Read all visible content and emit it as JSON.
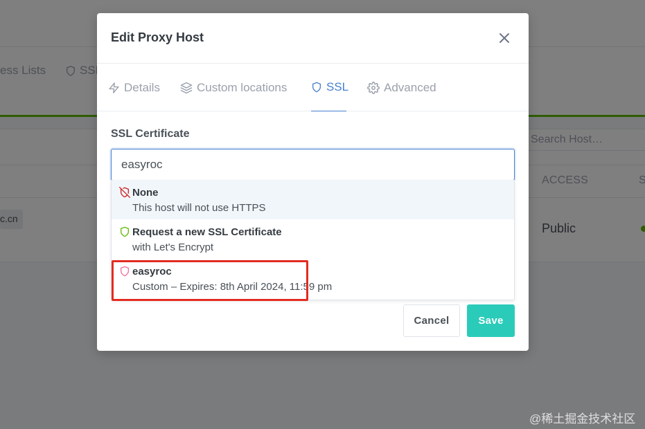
{
  "background": {
    "nav": {
      "access_lists_label": "ess Lists",
      "ssl_label": "SSL"
    },
    "search": {
      "placeholder": "Search Host…"
    },
    "table": {
      "col_access": "ACCESS",
      "col_status": "S",
      "row": {
        "host_fragment": "c.cn",
        "access": "Public"
      }
    }
  },
  "modal": {
    "title": "Edit Proxy Host",
    "tabs": [
      {
        "label": "Details",
        "icon": "bolt-icon"
      },
      {
        "label": "Custom locations",
        "icon": "layers-icon"
      },
      {
        "label": "SSL",
        "icon": "shield-icon"
      },
      {
        "label": "Advanced",
        "icon": "gear-icon"
      }
    ],
    "active_tab": "SSL",
    "ssl": {
      "label": "SSL Certificate",
      "input_value": "easyroc",
      "options": [
        {
          "title": "None",
          "subtitle": "This host will not use HTTPS",
          "icon": "shield-off-icon",
          "icon_color": "#cd201f"
        },
        {
          "title": "Request a new SSL Certificate",
          "subtitle": "with Let's Encrypt",
          "icon": "shield-icon",
          "icon_color": "#5eba00"
        },
        {
          "title": "easyroc",
          "subtitle": "Custom – Expires: 8th April 2024, 11:59 pm",
          "icon": "shield-icon",
          "icon_color": "#f66d9b"
        }
      ]
    },
    "buttons": {
      "cancel": "Cancel",
      "save": "Save"
    }
  },
  "colors": {
    "accent": "#467fcf",
    "save": "#2bcbba",
    "highlight": "#e32b22",
    "status_green": "#5eba00"
  },
  "watermark": "@稀土掘金技术社区"
}
